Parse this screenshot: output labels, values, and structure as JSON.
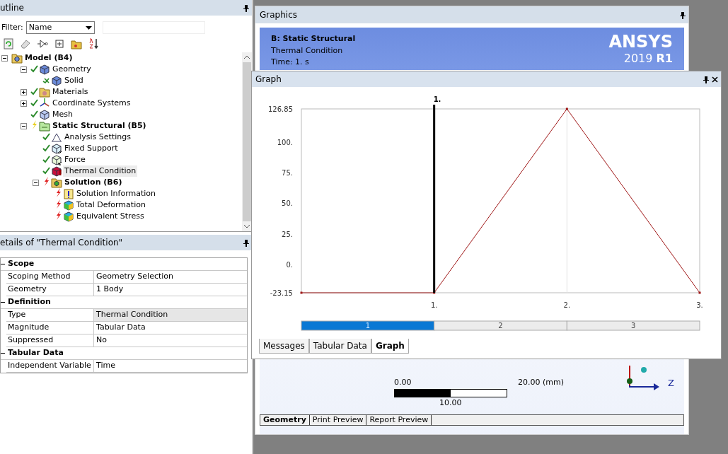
{
  "outline": {
    "title": "utline",
    "filter": {
      "label": "Filter:",
      "value": "Name"
    },
    "tree": [
      {
        "label": "Model (B4)",
        "kind": "folder",
        "bold": true,
        "expanded": true,
        "selected": false,
        "children": [
          {
            "label": "Geometry",
            "kind": "cube",
            "status": {
              "kind": "ok"
            },
            "bold": false,
            "expanded": true,
            "selected": false,
            "children": [
              {
                "label": "Solid",
                "kind": "cube",
                "status": {
                  "kind": "ok-part"
                },
                "bold": false,
                "selected": false
              }
            ]
          },
          {
            "label": "Materials",
            "kind": "materials",
            "status": {
              "kind": "ok"
            },
            "bold": false,
            "expanded": false,
            "selected": false
          },
          {
            "label": "Coordinate Systems",
            "kind": "axes",
            "status": {
              "kind": "ok"
            },
            "bold": false,
            "expanded": false,
            "selected": false
          },
          {
            "label": "Mesh",
            "kind": "mesh",
            "status": {
              "kind": "ok"
            },
            "bold": false,
            "selected": false
          },
          {
            "label": "Static Structural (B5)",
            "kind": "analysis",
            "status": {
              "kind": "pending"
            },
            "bold": true,
            "expanded": true,
            "selected": false,
            "children": [
              {
                "label": "Analysis Settings",
                "kind": "settings",
                "status": {
                  "kind": "ok"
                },
                "bold": false,
                "selected": false
              },
              {
                "label": "Fixed Support",
                "kind": "support",
                "status": {
                  "kind": "ok"
                },
                "bold": false,
                "selected": false
              },
              {
                "label": "Force",
                "kind": "force",
                "status": {
                  "kind": "ok"
                },
                "bold": false,
                "selected": false
              },
              {
                "label": "Thermal Condition",
                "kind": "thermal",
                "status": {
                  "kind": "ok"
                },
                "bold": false,
                "selected": true
              },
              {
                "label": "Solution (B6)",
                "kind": "solution",
                "status": {
                  "kind": "unsolved"
                },
                "bold": true,
                "expanded": true,
                "selected": false,
                "children": [
                  {
                    "label": "Solution Information",
                    "kind": "info",
                    "status": {
                      "kind": "unsolved"
                    },
                    "bold": false,
                    "selected": false
                  },
                  {
                    "label": "Total Deformation",
                    "kind": "result",
                    "status": {
                      "kind": "unsolved"
                    },
                    "bold": false,
                    "selected": false
                  },
                  {
                    "label": "Equivalent Stress",
                    "kind": "result",
                    "status": {
                      "kind": "unsolved"
                    },
                    "bold": false,
                    "selected": false
                  }
                ]
              }
            ]
          }
        ]
      }
    ]
  },
  "details": {
    "title": "etails of \"Thermal Condition\"",
    "sections": [
      {
        "label": "Scope",
        "expanded": true,
        "rows": [
          {
            "name": "Scoping Method",
            "value": "Geometry Selection",
            "selected": false
          },
          {
            "name": "Geometry",
            "value": "1 Body",
            "selected": false
          }
        ]
      },
      {
        "label": "Definition",
        "expanded": true,
        "rows": [
          {
            "name": "Type",
            "value": "Thermal Condition",
            "selected": true
          },
          {
            "name": "Magnitude",
            "value": "Tabular Data",
            "selected": false
          },
          {
            "name": "Suppressed",
            "value": "No",
            "selected": false
          }
        ]
      },
      {
        "label": "Tabular Data",
        "expanded": true,
        "rows": [
          {
            "name": "Independent Variable",
            "value": "Time",
            "selected": false
          }
        ]
      }
    ]
  },
  "graphics": {
    "title": "Graphics",
    "banner": {
      "heading": "B: Static Structural",
      "lines": [
        "Thermal Condition",
        "Time: 1. s"
      ],
      "logo": "ANSYS",
      "version": "2019 **R1**"
    },
    "scale": {
      "start": "0.00",
      "end": "20.00 (mm)",
      "middle": "10.00"
    },
    "axis_label": "Z",
    "tabs": [
      {
        "label": "Geometry",
        "selected": true
      },
      {
        "label": "Print Preview",
        "selected": false
      },
      {
        "label": "Report Preview",
        "selected": false
      }
    ]
  },
  "graph": {
    "title": "Graph",
    "chart_data": {
      "type": "line",
      "x": [
        0,
        1,
        2,
        3
      ],
      "series": [
        {
          "color": "#a01818",
          "marker": "square",
          "values": [
            -23.15,
            -23.15,
            126.85,
            -23.15
          ]
        }
      ],
      "xlim": [
        0,
        3
      ],
      "ylim": [
        -23.15,
        126.85
      ],
      "xticks": [
        {
          "value": 1,
          "label": "1."
        },
        {
          "value": 2,
          "label": "2."
        },
        {
          "value": 3,
          "label": "3."
        }
      ],
      "yticks": [
        {
          "value": -23.15,
          "label": "-23.15"
        },
        {
          "value": 0,
          "label": "0."
        },
        {
          "value": 25,
          "label": "25."
        },
        {
          "value": 50,
          "label": "50."
        },
        {
          "value": 75,
          "label": "75."
        },
        {
          "value": 100,
          "label": "100."
        },
        {
          "value": 126.85,
          "label": "126.85"
        }
      ],
      "annotations": [
        {
          "x": 1,
          "text": "1."
        }
      ],
      "ref_lines": [
        {
          "axis": "x",
          "value": 2,
          "color": "#e2e2e2"
        }
      ]
    },
    "steps": [
      {
        "label": "1",
        "selected": true
      },
      {
        "label": "2",
        "selected": false
      },
      {
        "label": "3",
        "selected": false
      }
    ],
    "tabs": [
      {
        "label": "Messages",
        "selected": false
      },
      {
        "label": "Tabular Data",
        "selected": false
      },
      {
        "label": "Graph",
        "selected": true
      }
    ]
  }
}
